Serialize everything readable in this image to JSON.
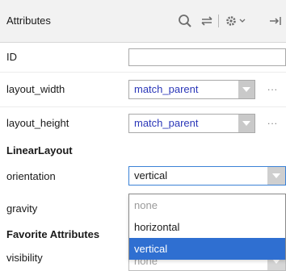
{
  "header": {
    "title": "Attributes",
    "icons": [
      "search-icon",
      "swap-icon",
      "gear-icon",
      "chevron-down-icon",
      "collapse-icon"
    ]
  },
  "rows": {
    "id": {
      "label": "ID",
      "value": ""
    },
    "layout_width": {
      "label": "layout_width",
      "value": "match_parent",
      "more": "..."
    },
    "layout_height": {
      "label": "layout_height",
      "value": "match_parent",
      "more": "..."
    }
  },
  "sections": {
    "linear_layout": "LinearLayout",
    "favorite": "Favorite Attributes"
  },
  "linear_layout": {
    "orientation": {
      "label": "orientation",
      "value": "vertical"
    },
    "gravity": {
      "label": "gravity"
    }
  },
  "favorite": {
    "visibility": {
      "label": "visibility",
      "value": "none"
    }
  },
  "dropdown": {
    "options": [
      "none",
      "horizontal",
      "vertical"
    ],
    "selected": "vertical"
  },
  "colors": {
    "value_text": "#2b37b8",
    "selection": "#2f6fd1",
    "focus_border": "#3b82d6"
  }
}
